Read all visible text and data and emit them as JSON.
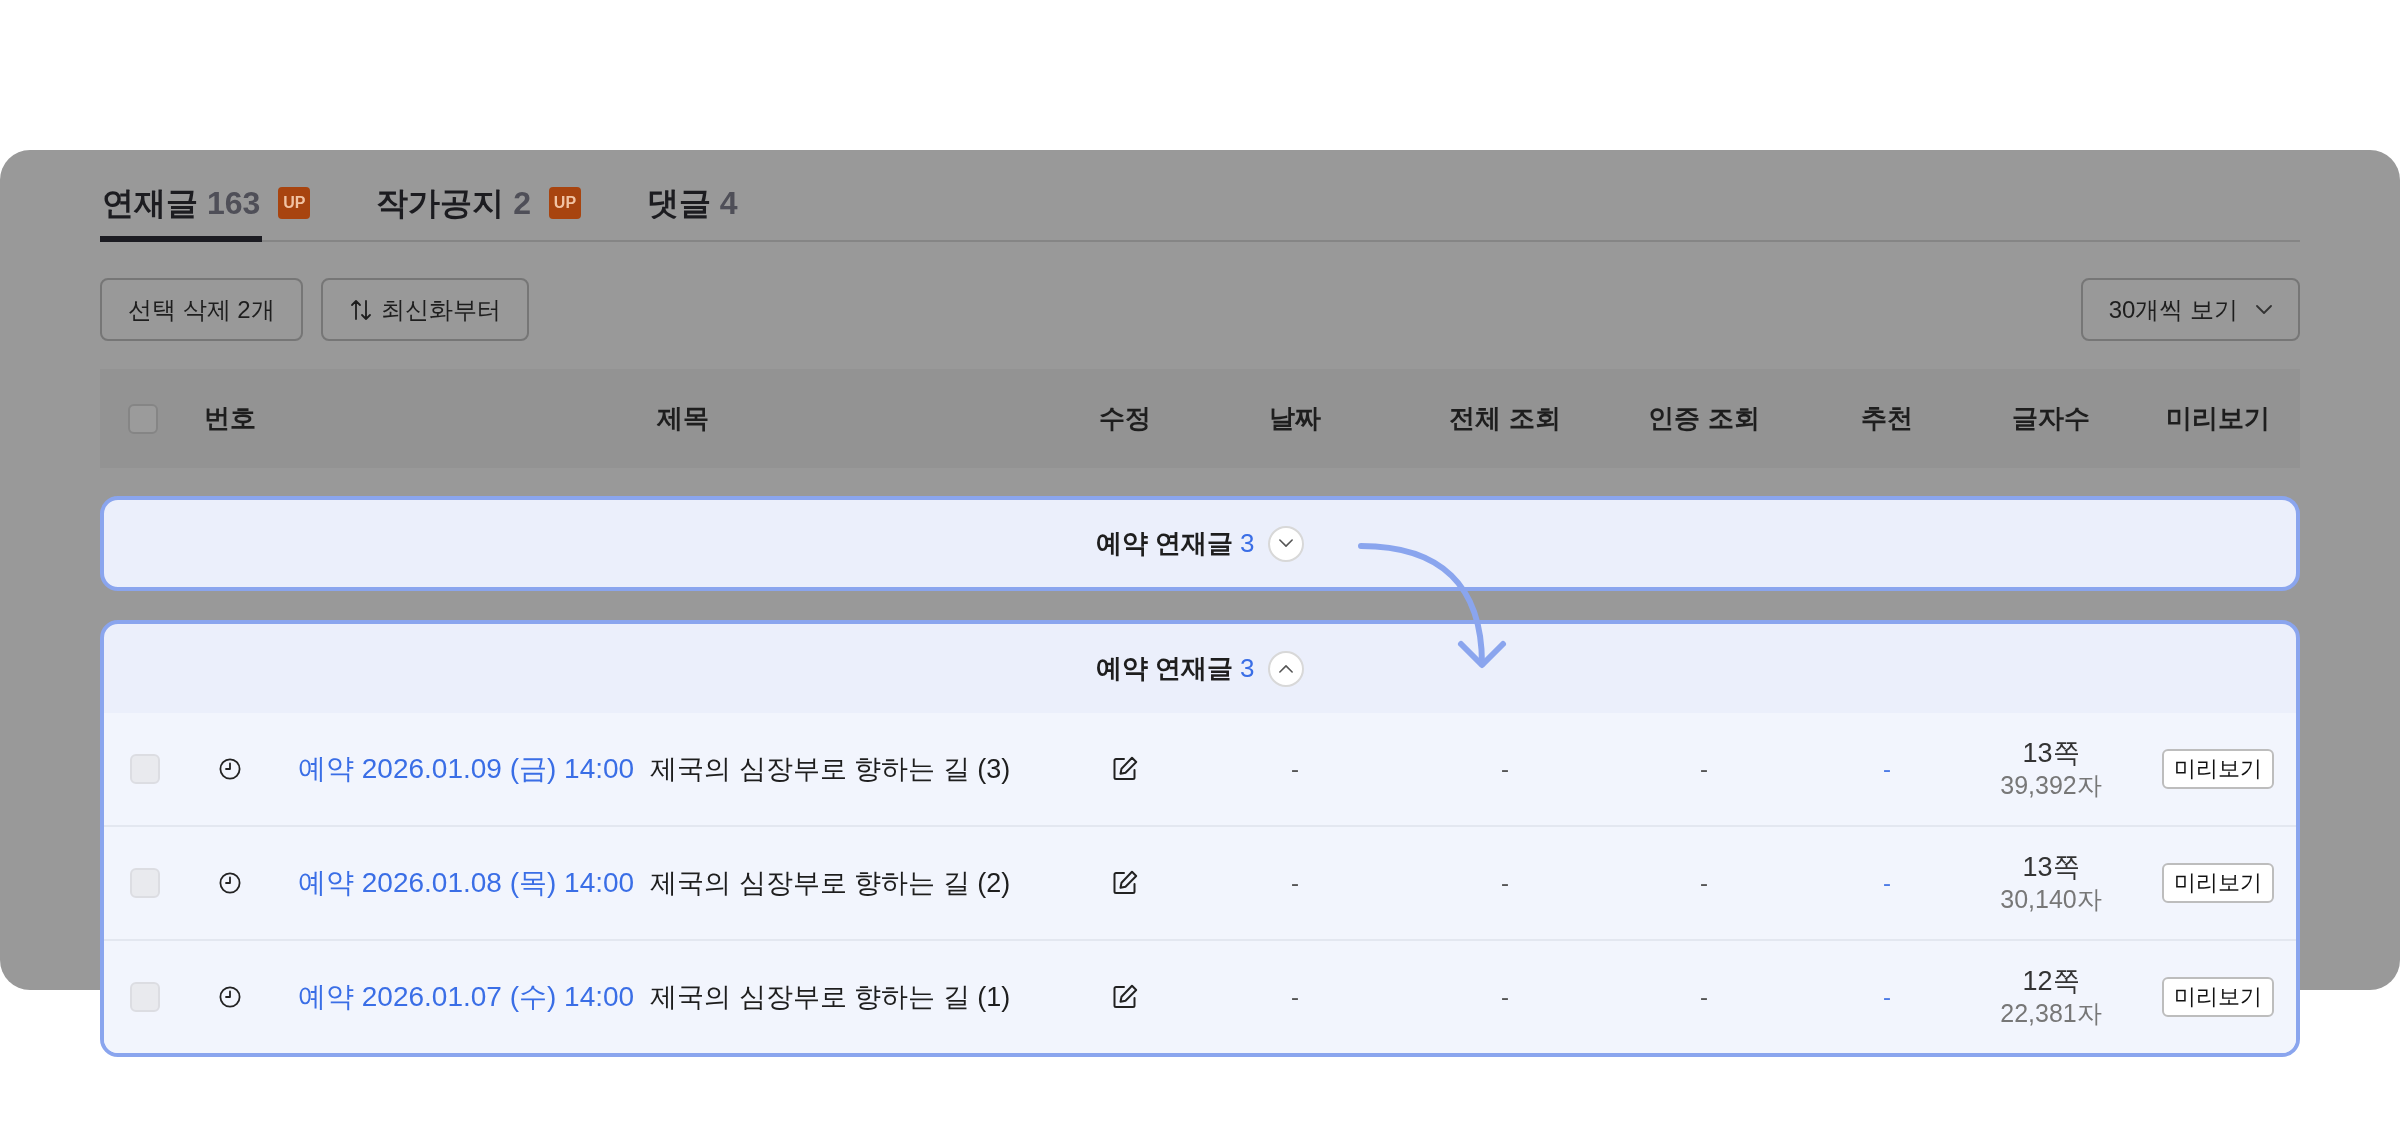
{
  "tabs": [
    {
      "label": "연재글",
      "count": "163",
      "badge": "UP",
      "selected": true
    },
    {
      "label": "작가공지",
      "count": "2",
      "badge": "UP",
      "selected": false
    },
    {
      "label": "댓글",
      "count": "4",
      "selected": false
    }
  ],
  "toolbar": {
    "delete_button": "선택 삭제 2개",
    "sort_button": "최신화부터",
    "page_size": "30개씩 보기"
  },
  "table": {
    "select_all": {
      "checked": false
    },
    "columns": [
      "번호",
      "제목",
      "수정",
      "날짜",
      "전체 조회",
      "인증 조회",
      "추천",
      "글자수",
      "미리보기"
    ]
  },
  "scheduled_groups": [
    {
      "label": "예약 연재글",
      "count": "3",
      "expanded": false
    },
    {
      "label": "예약 연재글",
      "count": "3",
      "expanded": true,
      "rows": [
        {
          "checked": false,
          "disabled": true,
          "schedule": "예약 2026.01.09 (금) 14:00",
          "title": "제국의 심장부로 향하는 길 (3)",
          "date": "-",
          "total_views": "-",
          "verified_views": "-",
          "recommend": "-",
          "pages": "13쪽",
          "chars": "39,392자",
          "preview": "미리보기"
        },
        {
          "checked": false,
          "disabled": true,
          "schedule": "예약 2026.01.08 (목) 14:00",
          "title": "제국의 심장부로 향하는 길 (2)",
          "date": "-",
          "total_views": "-",
          "verified_views": "-",
          "recommend": "-",
          "pages": "13쪽",
          "chars": "30,140자",
          "preview": "미리보기"
        },
        {
          "checked": false,
          "disabled": true,
          "schedule": "예약 2026.01.07 (수) 14:00",
          "title": "제국의 심장부로 향하는 길 (1)",
          "date": "-",
          "total_views": "-",
          "verified_views": "-",
          "recommend": "-",
          "pages": "12쪽",
          "chars": "22,381자",
          "preview": "미리보기"
        }
      ]
    }
  ]
}
